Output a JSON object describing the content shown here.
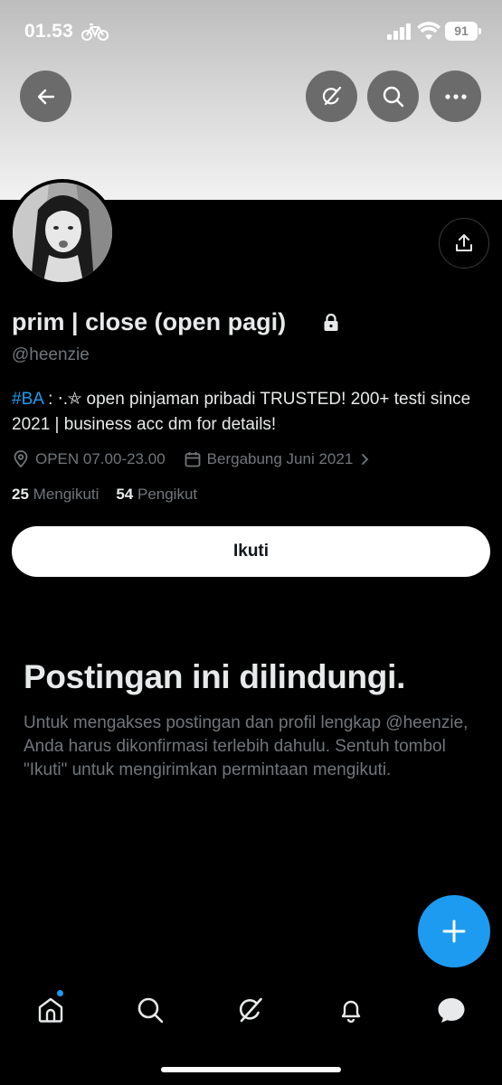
{
  "status_bar": {
    "time": "01.53",
    "battery": "91"
  },
  "profile": {
    "display_name": "prim | close (open pagi)",
    "handle": "@heenzie",
    "bio_hashtag": "#BA",
    "bio_text": " : ⋅.⛤ open pinjaman pribadi TRUSTED! 200+ testi since 2021 | business acc dm for details!",
    "location": "OPEN 07.00-23.00",
    "joined": "Bergabung Juni 2021",
    "following_count": "25",
    "following_label": "Mengikuti",
    "followers_count": "54",
    "followers_label": "Pengikut",
    "follow_button": "Ikuti"
  },
  "protected": {
    "title": "Postingan ini dilindungi.",
    "description": "Untuk mengakses postingan dan profil lengkap @heenzie, Anda harus dikonfirmasi terlebih dahulu. Sentuh tombol \"Ikuti\" untuk mengirimkan permintaan mengikuti."
  },
  "icons": {
    "back": "arrow-left-icon",
    "grok": "grok-icon",
    "search": "search-icon",
    "more": "more-icon",
    "share": "share-icon",
    "lock": "lock-icon",
    "location": "location-pin-icon",
    "calendar": "calendar-icon",
    "compose": "plus-icon",
    "nav": [
      "home-icon",
      "search-icon",
      "grok-icon",
      "bell-icon",
      "message-icon"
    ]
  },
  "colors": {
    "accent": "#1d9bf0",
    "background": "#000000",
    "muted_text": "#71767b"
  }
}
